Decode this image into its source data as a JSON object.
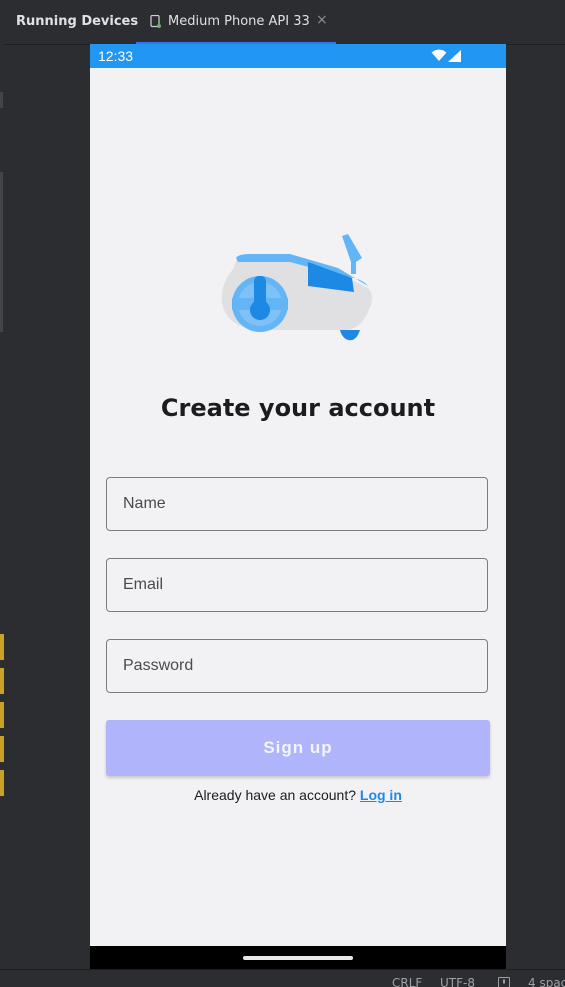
{
  "ide": {
    "panel_title": "Running Devices",
    "device_tab_label": "Medium Phone API 33",
    "device_tab_close": "×",
    "status_items": [
      "CRLF",
      "UTF-8",
      "4 spac"
    ]
  },
  "phone": {
    "status_time": "12:33",
    "status_bar_color": "#2196f3",
    "title": "Create your account",
    "fields": [
      {
        "placeholder": "Name"
      },
      {
        "placeholder": "Email"
      },
      {
        "placeholder": "Password"
      }
    ],
    "signup_label": "Sign up",
    "signup_color": "#b0b4fb",
    "login_prompt": "Already have an account?",
    "login_link": "Log in",
    "link_color": "#1e88e5",
    "hero_icon": "robot-vacuum-icon"
  }
}
